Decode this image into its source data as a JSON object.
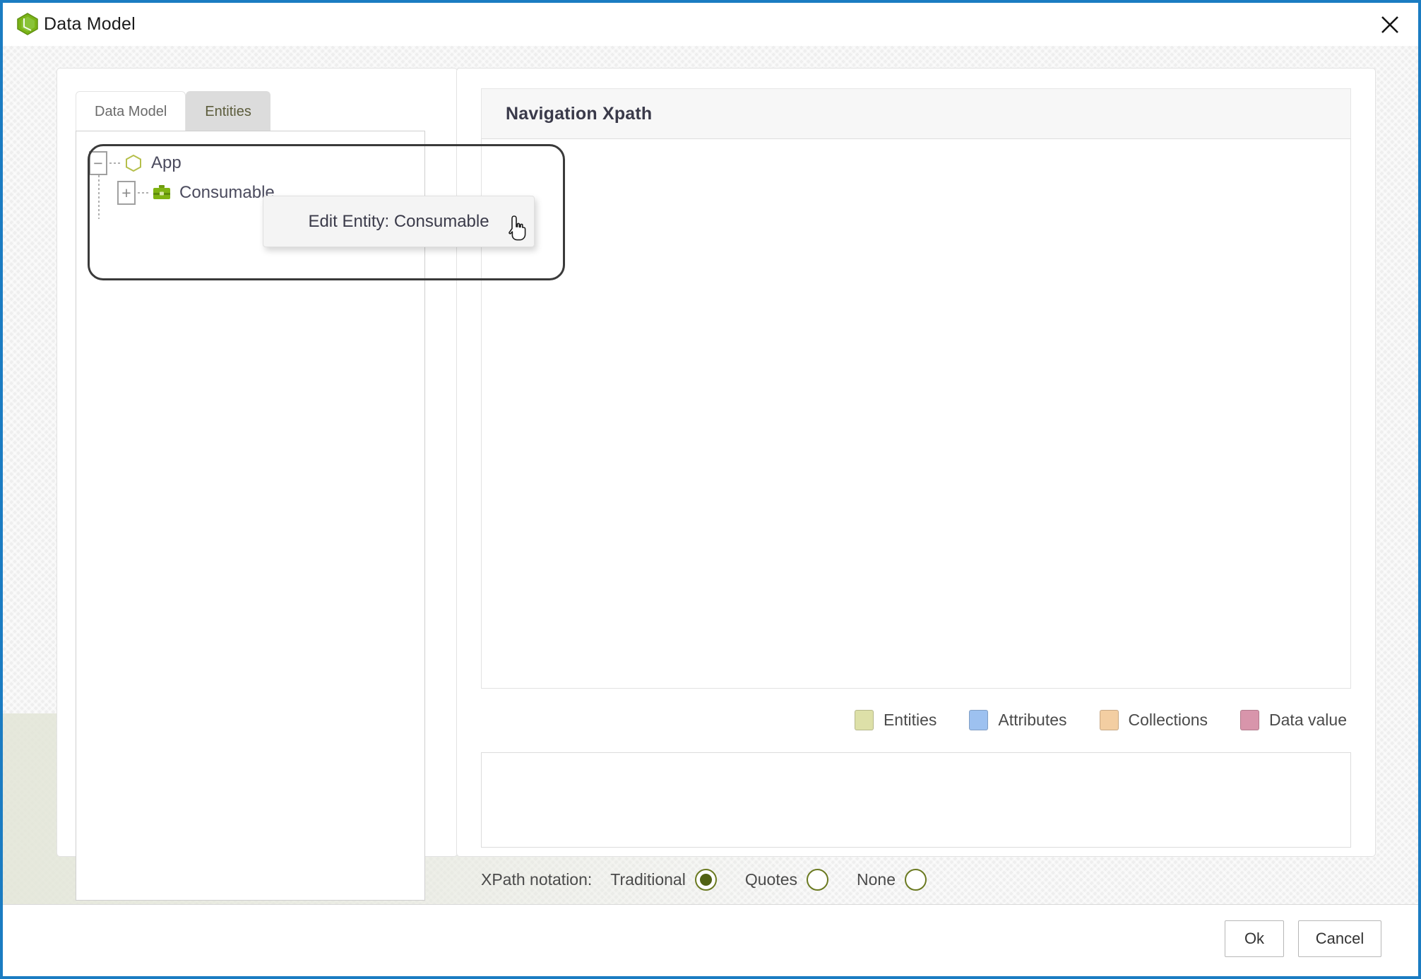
{
  "window": {
    "title": "Data Model",
    "logo_icon": "hexagon-cube-logo-icon",
    "close_icon": "close-icon",
    "accent_color": "#1b7cc2"
  },
  "left_panel": {
    "tabs": [
      {
        "label": "Data Model",
        "active": false
      },
      {
        "label": "Entities",
        "active": true
      }
    ],
    "tree": {
      "nodes": [
        {
          "label": "App",
          "icon": "hexagon-outline-icon",
          "toggle": "−",
          "expanded": true
        },
        {
          "label": "Consumable",
          "icon": "briefcase-icon",
          "toggle": "+",
          "expanded": false
        }
      ]
    },
    "context_menu": {
      "item_label": "Edit Entity: Consumable"
    },
    "cursor_icon": "pointing-hand-cursor-icon"
  },
  "right_panel": {
    "header_title": "Navigation Xpath",
    "canvas_content": "",
    "legend": [
      {
        "label": "Entities",
        "color": "#dde0a8"
      },
      {
        "label": "Attributes",
        "color": "#9dc1f0"
      },
      {
        "label": "Collections",
        "color": "#f3ceA2"
      },
      {
        "label": "Data value",
        "color": "#d895ab"
      }
    ],
    "xpath_value": "",
    "notation": {
      "label": "XPath notation:",
      "options": [
        {
          "label": "Traditional",
          "selected": true
        },
        {
          "label": "Quotes",
          "selected": false
        },
        {
          "label": "None",
          "selected": false
        }
      ]
    }
  },
  "footer": {
    "ok_label": "Ok",
    "cancel_label": "Cancel"
  }
}
